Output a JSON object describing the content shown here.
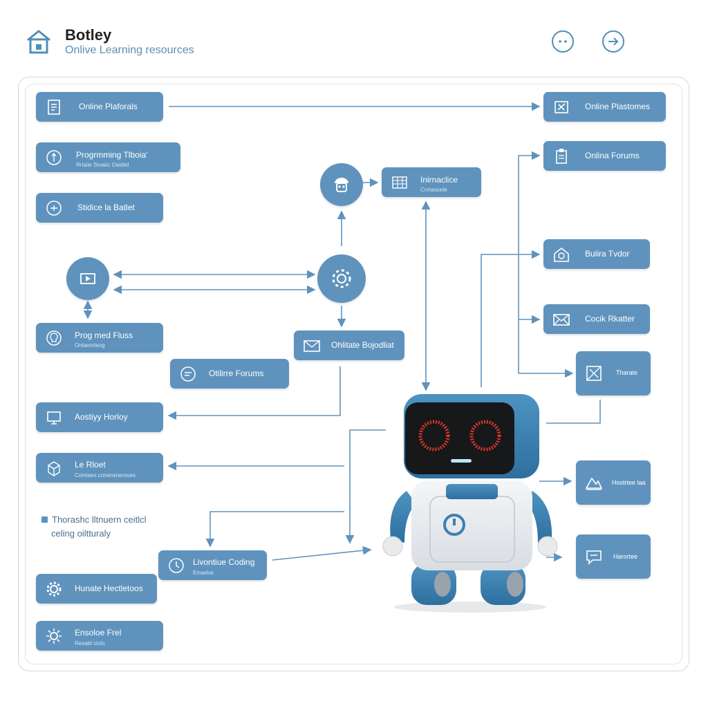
{
  "header": {
    "title": "Botley",
    "subtitle": "Onlive Learning resources",
    "logo_icon": "home-icon",
    "buttons": [
      {
        "name": "more-options-button",
        "icon": "dots-icon"
      },
      {
        "name": "next-button",
        "icon": "arrow-right-icon"
      }
    ]
  },
  "colors": {
    "node": "#5f93bd",
    "line": "#5f93bd",
    "accent": "#3f7fb0",
    "robot_eyes": "#e0352b"
  },
  "left_nodes": [
    {
      "label": "Online Plaforals",
      "sub": "",
      "icon": "document-icon"
    },
    {
      "label": "Progrmming Tlboia'",
      "sub": "Rrlaiie Sroaiic Oaidiel",
      "icon": "lightbulb-icon"
    },
    {
      "label": "Stidice la Batlet",
      "sub": "",
      "icon": "chat-icon"
    },
    {
      "label": "Prog med Fluss",
      "sub": "Onlaesrteog",
      "icon": "lightbulb-icon"
    },
    {
      "label": "Aostiyy Horloy",
      "sub": "",
      "icon": "monitor-icon"
    },
    {
      "label": "Le Rloet",
      "sub": "Comiaes conensnersoes",
      "icon": "cube-icon"
    },
    {
      "label": "Hunate Hectletoos",
      "sub": "",
      "icon": "gear-icon"
    },
    {
      "label": "Ensoloe Frel",
      "sub": "Resabl clolo",
      "icon": "sun-icon"
    }
  ],
  "right_nodes": [
    {
      "label": "Online Plastomes",
      "icon": "tools-icon"
    },
    {
      "label": "Onlina Forums",
      "icon": "clipboard-icon"
    },
    {
      "label": "Bulira Tvdor",
      "icon": "home-robot-icon"
    },
    {
      "label": "Cocik Rkatter",
      "icon": "envelope-icon"
    },
    {
      "label": "Tharate",
      "icon": "image-icon"
    },
    {
      "label": "Hostrtee laa",
      "icon": "mountain-icon"
    },
    {
      "label": "Harortee",
      "icon": "speech-icon"
    }
  ],
  "center_nodes": {
    "interactive": {
      "label": "Inirnaclice",
      "sub": "Cnrtaocele",
      "icon": "grid-icon"
    },
    "email": {
      "label": "Ohlitate Bojodliat",
      "icon": "mail-icon"
    },
    "forums": {
      "label": "Otilirre Forums",
      "icon": "chat-bubble-icon"
    },
    "coding": {
      "label": "Livontiue Coding",
      "sub": "Erraeloe",
      "icon": "clock-icon"
    }
  },
  "circles": [
    {
      "name": "robot-face-circle",
      "icon": "robot-head-icon"
    },
    {
      "name": "settings-circle",
      "icon": "gear-icon"
    },
    {
      "name": "video-circle",
      "icon": "play-icon"
    }
  ],
  "note": {
    "line1": "Thorashc lltnuern ceitlcl",
    "line2": "celing oiltturaly"
  }
}
